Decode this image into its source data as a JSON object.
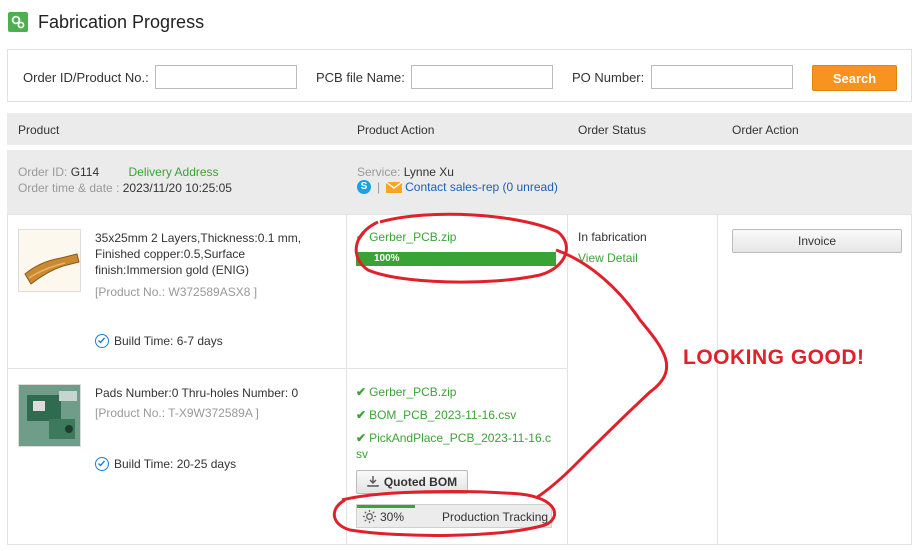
{
  "header": {
    "title": "Fabrication Progress"
  },
  "filters": {
    "order_label": "Order ID/Product No.:",
    "pcb_label": "PCB file Name:",
    "po_label": "PO Number:",
    "order_value": "",
    "pcb_value": "",
    "po_value": "",
    "search_label": "Search"
  },
  "table": {
    "columns": [
      "Product",
      "Product Action",
      "Order Status",
      "Order Action"
    ]
  },
  "order": {
    "id_label": "Order ID:",
    "id_value": "G114",
    "delivery_link": "Delivery Address",
    "time_label": "Order time & date :",
    "time_value": "2023/11/20 10:25:05",
    "service_label": "Service:",
    "service_value": "Lynne Xu",
    "separator": "|",
    "contact_link": "Contact sales-rep (0 unread)"
  },
  "products": [
    {
      "desc_line1": "35x25mm 2 Layers,Thickness:0.1 mm,",
      "desc_line2": "Finished copper:0.5,Surface",
      "desc_line3": "finish:Immersion gold (ENIG)",
      "product_no": "[Product No.: W372589ASX8 ]",
      "build_time": "Build Time: 6-7 days",
      "files": [
        "Gerber_PCB.zip"
      ],
      "progress": 100,
      "progress_label": "100%",
      "status": "In fabrication",
      "status_link": "View Detail",
      "invoice_label": "Invoice"
    },
    {
      "desc_line1": "Pads Number:0 Thru-holes Number: 0",
      "product_no": "[Product No.: T-X9W372589A ]",
      "build_time": "Build Time: 20-25 days",
      "files": [
        "Gerber_PCB.zip",
        "BOM_PCB_2023-11-16.csv",
        "PickAndPlace_PCB_2023-11-16.c",
        "sv"
      ],
      "quoted_bom_label": "Quoted BOM",
      "progress": 30,
      "progress_label": "30%",
      "tracking_label": "Production Tracking"
    }
  ],
  "annotation": {
    "text": "LOOKING GOOD!",
    "color": "#e0202a"
  },
  "colors": {
    "accent": "#f7931e",
    "success": "#3aa335",
    "link": "#1a5fb4"
  }
}
